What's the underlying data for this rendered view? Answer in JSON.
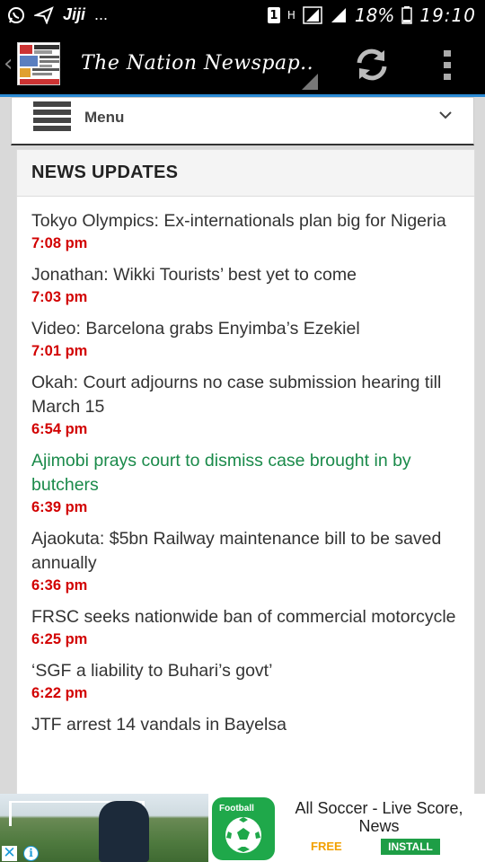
{
  "status_bar": {
    "app_hint": "Jiji",
    "ellipsis": "...",
    "sim_slot": "1",
    "network_type": "H",
    "battery": "18%",
    "time": "19:10"
  },
  "app_bar": {
    "title": "The Nation Newspap..",
    "accent_color": "#2a8ad4"
  },
  "menu": {
    "label": "Menu"
  },
  "section": {
    "title": "NEWS UPDATES"
  },
  "news": [
    {
      "title": "Tokyo Olympics: Ex-internationals plan big for Nigeria",
      "time": "7:08 pm",
      "visited": false
    },
    {
      "title": "Jonathan: Wikki Tourists’ best yet to come",
      "time": "7:03 pm",
      "visited": false
    },
    {
      "title": "Video: Barcelona grabs Enyimba’s Ezekiel",
      "time": "7:01 pm",
      "visited": false
    },
    {
      "title": "Okah: Court adjourns no case submission hearing till March 15",
      "time": "6:54 pm",
      "visited": false
    },
    {
      "title": "Ajimobi prays court to dismiss case brought in by butchers",
      "time": "6:39 pm",
      "visited": true
    },
    {
      "title": "Ajaokuta: $5bn Railway maintenance bill to be saved annually",
      "time": "6:36 pm",
      "visited": false
    },
    {
      "title": "FRSC seeks nationwide ban of commercial motorcycle",
      "time": "6:25 pm",
      "visited": false
    },
    {
      "title": "‘SGF a liability to Buhari’s govt’",
      "time": "6:22 pm",
      "visited": false
    },
    {
      "title": "JTF arrest 14 vandals in Bayelsa",
      "time": "",
      "visited": false
    }
  ],
  "colors": {
    "time": "#d20000",
    "visited_link": "#1a8a4a"
  },
  "ad": {
    "app_name": "All Soccer - Live Score, News",
    "price": "FREE",
    "cta": "INSTALL",
    "icon_tag": "Football",
    "close_symbol": "✕",
    "info_symbol": "i"
  }
}
